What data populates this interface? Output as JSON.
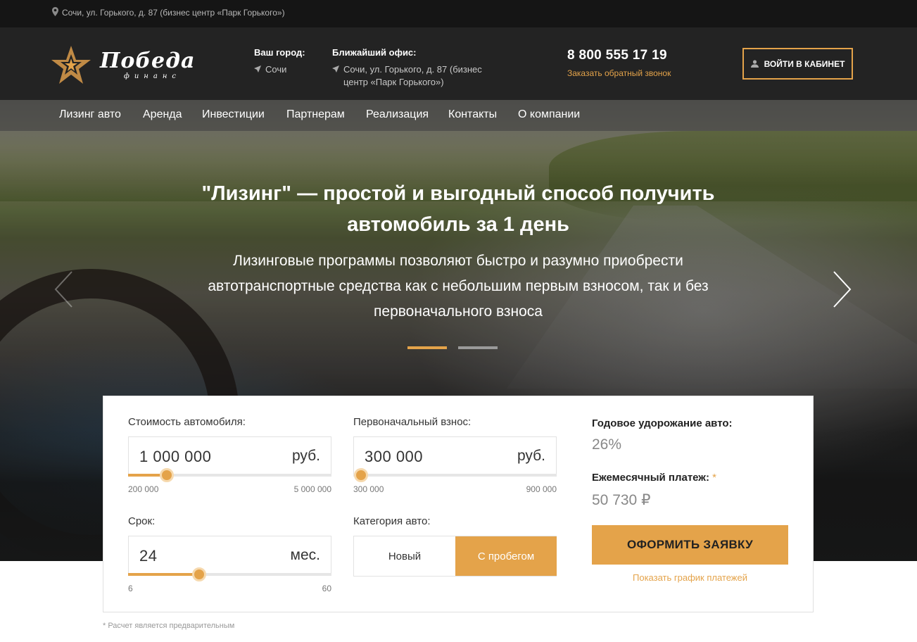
{
  "topbar": {
    "address": "Сочи, ул. Горького, д. 87 (бизнес центр «Парк Горького»)"
  },
  "logo": {
    "name": "Победа",
    "sub": "финанс"
  },
  "header": {
    "city_label": "Ваш город:",
    "city_value": "Сочи",
    "office_label": "Ближайший офис:",
    "office_value": "Сочи, ул. Горького, д. 87 (бизнес центр «Парк Горького»)",
    "phone": "8 800 555 17 19",
    "callback": "Заказать обратный звонок",
    "cabinet_button": "ВОЙТИ В КАБИНЕТ"
  },
  "nav": {
    "items": [
      "Лизинг авто",
      "Аренда",
      "Инвестиции",
      "Партнерам",
      "Реализация",
      "Контакты",
      "О компании"
    ]
  },
  "hero": {
    "title": "\"Лизинг\" — простой и выгодный способ получить автомобиль за 1 день",
    "subtitle": "Лизинговые программы позволяют быстро и разумно приобрести автотранспортные средства как с небольшим первым взносом, так и без первоначального взноса",
    "slides_total": 2,
    "active_slide": 1
  },
  "calculator": {
    "cost": {
      "label": "Стоимость автомобиля:",
      "value": "1 000 000",
      "unit": "руб.",
      "min": "200 000",
      "max": "5 000 000",
      "level": 0.19
    },
    "down_payment": {
      "label": "Первоначальный взнос:",
      "value": "300 000",
      "unit": "руб.",
      "min": "300 000",
      "max": "900 000",
      "level": 0.0
    },
    "term": {
      "label": "Срок:",
      "value": "24",
      "unit": "мес.",
      "min": "6",
      "max": "60",
      "level": 0.35
    },
    "category": {
      "label": "Категория авто:",
      "options": [
        "Новый",
        "С пробегом"
      ],
      "selected": "С пробегом"
    },
    "appreciation": {
      "label": "Годовое удорожание авто:",
      "value": "26%"
    },
    "monthly": {
      "label": "Ежемесячный платеж:",
      "asterisk": "*",
      "value": "50 730 ₽"
    },
    "order_button": "ОФОРМИТЬ ЗАЯВКУ",
    "schedule_link": "Показать график платежей"
  },
  "footnote": "* Расчет является предварительным",
  "colors": {
    "accent": "#e4a34a",
    "header_bg": "#232323",
    "topbar_bg": "#151515"
  }
}
